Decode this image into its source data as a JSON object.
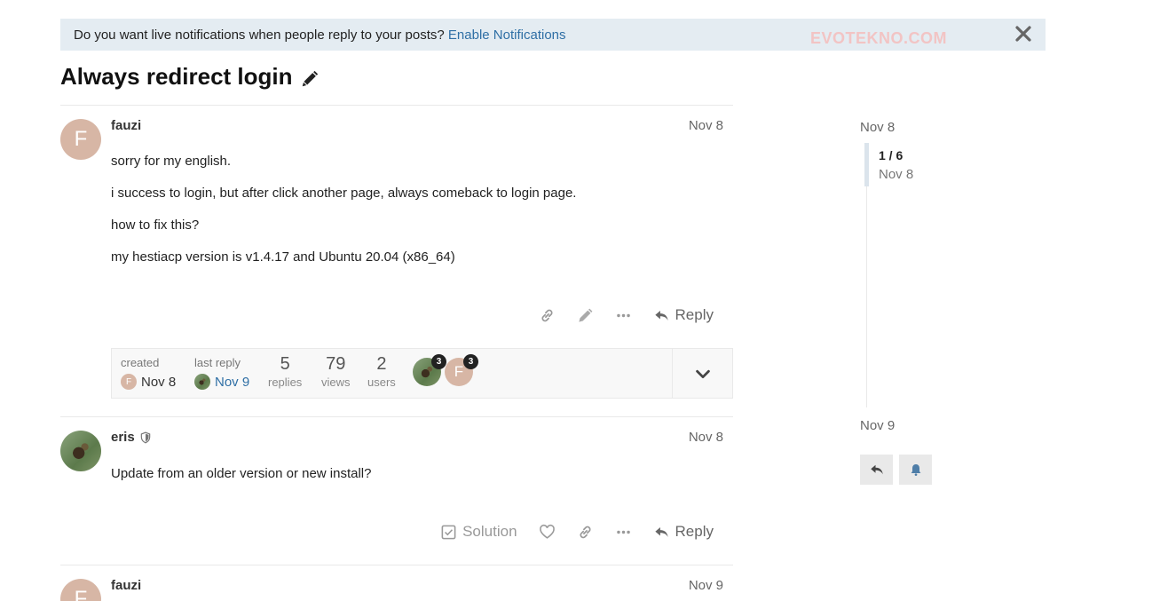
{
  "notification": {
    "text": "Do you want live notifications when people reply to your posts?",
    "link_label": "Enable Notifications",
    "close_icon": "close-icon"
  },
  "watermark": "EVOTEKNO.COM",
  "topic": {
    "title": "Always redirect login",
    "edit_icon": "pencil-icon"
  },
  "posts": [
    {
      "avatar_letter": "F",
      "username": "fauzi",
      "date": "Nov 8",
      "paragraphs": [
        "sorry for my english.",
        "i success to login, but after click another page, always comeback to login page.",
        "how to fix this?",
        "my hestiacp version is v1.4.17 and Ubuntu 20.04 (x86_64)"
      ],
      "reply_label": "Reply"
    },
    {
      "username": "eris",
      "date": "Nov 8",
      "paragraphs": [
        "Update from an older version or new install?"
      ],
      "solution_label": "Solution",
      "reply_label": "Reply"
    },
    {
      "avatar_letter": "F",
      "username": "fauzi",
      "date": "Nov 9"
    }
  ],
  "topic_map": {
    "created_label": "created",
    "created_avatar": "F",
    "created_date": "Nov 8",
    "last_reply_label": "last reply",
    "last_reply_date": "Nov 9",
    "stats": [
      {
        "num": "5",
        "label": "replies"
      },
      {
        "num": "79",
        "label": "views"
      },
      {
        "num": "2",
        "label": "users"
      }
    ],
    "participants": [
      {
        "badge": "3"
      },
      {
        "letter": "F",
        "badge": "3"
      }
    ]
  },
  "timeline": {
    "start_date": "Nov 8",
    "position": "1 / 6",
    "position_date": "Nov 8",
    "end_date": "Nov 9"
  },
  "colors": {
    "notice_bg": "#e4ecf2",
    "link": "#2f6fa5",
    "avatar_f": "#d7b6a5"
  }
}
